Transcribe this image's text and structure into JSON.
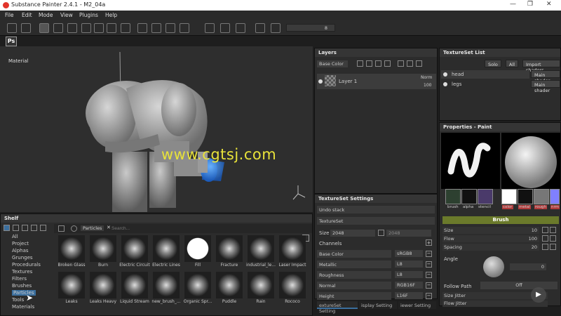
{
  "window": {
    "title": "Substance Painter 2.4.1 - M2_04a"
  },
  "menu": [
    "File",
    "Edit",
    "Mode",
    "View",
    "Plugins",
    "Help"
  ],
  "toolbar": {
    "size_value": "8"
  },
  "viewport": {
    "label": "Material"
  },
  "watermark": "www.cgtsj.com",
  "layers": {
    "title": "Layers",
    "channel_select": "Base Color",
    "layer": {
      "name": "Layer 1",
      "blend": "Norm",
      "opacity": "100"
    }
  },
  "texture_set_list": {
    "title": "TextureSet List",
    "solo": "Solo",
    "all": "All",
    "import": "Import shaders",
    "items": [
      {
        "name": "head",
        "shader": "Main shader"
      },
      {
        "name": "legs",
        "shader": "Main shader"
      }
    ]
  },
  "texture_set_settings": {
    "title": "TextureSet Settings",
    "undo": "Undo stack",
    "textureset": "TextureSet",
    "size_label": "Size",
    "size_value": "2048",
    "size_value2": "2048",
    "channels_label": "Channels",
    "channels": [
      {
        "name": "Base Color",
        "format": "sRGB8"
      },
      {
        "name": "Metallic",
        "format": "L8"
      },
      {
        "name": "Roughness",
        "format": "L8"
      },
      {
        "name": "Normal",
        "format": "RGB16F"
      },
      {
        "name": "Height",
        "format": "L16F"
      }
    ],
    "tabs": [
      "extureSet Setting",
      "isplay Setting",
      "iewer Setting"
    ]
  },
  "properties": {
    "title": "Properties - Paint",
    "mat_labels": [
      "brush",
      "alpha",
      "stencil"
    ],
    "mat_labels2": [
      "color",
      "metal",
      "rough",
      "nrm"
    ],
    "section": "Brush",
    "params": [
      {
        "label": "Size",
        "value": "10"
      },
      {
        "label": "Flow",
        "value": "100"
      },
      {
        "label": "Spacing",
        "value": "20"
      }
    ],
    "angle_label": "Angle",
    "angle_value": "0",
    "follow_path": "Follow Path",
    "follow_value": "Off",
    "jitter": [
      "Size Jitter",
      "Flow Jitter"
    ]
  },
  "shelf": {
    "title": "Shelf",
    "filter": "Particles",
    "search_placeholder": "Search...",
    "categories": [
      "All",
      "Project",
      "Alphas",
      "Grunges",
      "Procedurals",
      "Textures",
      "Filters",
      "Brushes",
      "Particles",
      "Tools",
      "Materials"
    ],
    "row1": [
      "Broken Glass",
      "Burn",
      "Electric Circuit",
      "Electric Lines",
      "Fill",
      "Fracture",
      "industrial_le...",
      "Laser Impact"
    ],
    "row2": [
      "Leaks",
      "Leaks Heavy",
      "Liquid Stream",
      "new_brush_...",
      "Organic Spr...",
      "Puddle",
      "Rain",
      "Rococo"
    ]
  },
  "colors": {
    "accent": "#3b6f9e",
    "brush_section": "#6b7a2b",
    "watermark": "#e8e23a"
  }
}
